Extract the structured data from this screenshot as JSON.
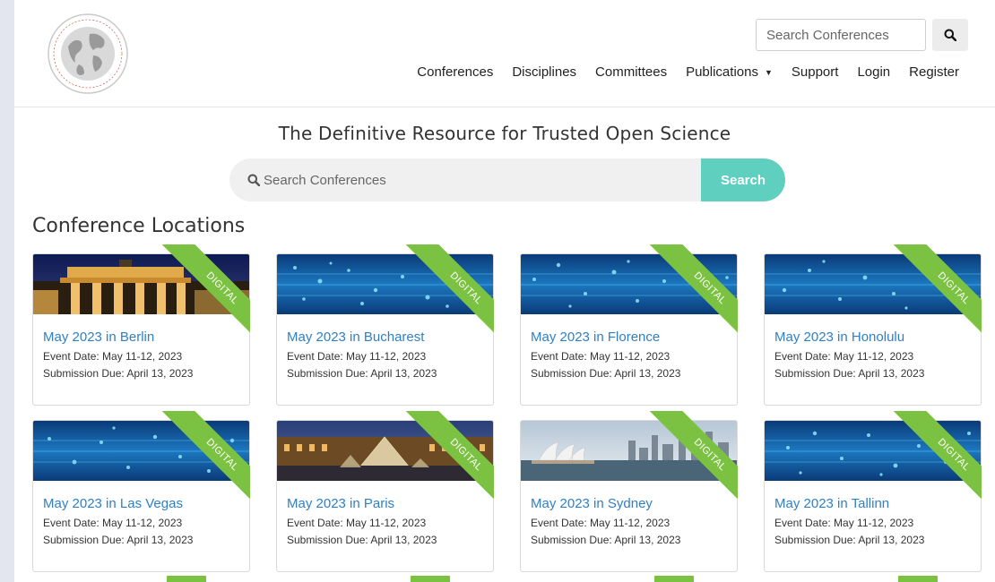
{
  "header": {
    "logo_text": "World Academy of Science, Engineering and Technology",
    "search_placeholder": "Search Conferences",
    "nav": [
      "Conferences",
      "Disciplines",
      "Committees",
      "Publications",
      "Support",
      "Login",
      "Register"
    ]
  },
  "hero": {
    "tagline": "The Definitive Resource for Trusted Open Science",
    "search_placeholder": "Search Conferences",
    "search_button": "Search"
  },
  "section_title": "Conference Locations",
  "ribbon_label": "DIGITAL",
  "cards": [
    {
      "title": "May 2023 in Berlin",
      "event": "Event Date: May 11-12, 2023",
      "due": "Submission Due: April 13, 2023",
      "image": "berlin"
    },
    {
      "title": "May 2023 in Bucharest",
      "event": "Event Date: May 11-12, 2023",
      "due": "Submission Due: April 13, 2023",
      "image": "digital"
    },
    {
      "title": "May 2023 in Florence",
      "event": "Event Date: May 11-12, 2023",
      "due": "Submission Due: April 13, 2023",
      "image": "digital"
    },
    {
      "title": "May 2023 in Honolulu",
      "event": "Event Date: May 11-12, 2023",
      "due": "Submission Due: April 13, 2023",
      "image": "digital"
    },
    {
      "title": "May 2023 in Las Vegas",
      "event": "Event Date: May 11-12, 2023",
      "due": "Submission Due: April 13, 2023",
      "image": "digital"
    },
    {
      "title": "May 2023 in Paris",
      "event": "Event Date: May 11-12, 2023",
      "due": "Submission Due: April 13, 2023",
      "image": "paris"
    },
    {
      "title": "May 2023 in Sydney",
      "event": "Event Date: May 11-12, 2023",
      "due": "Submission Due: April 13, 2023",
      "image": "sydney"
    },
    {
      "title": "May 2023 in Tallinn",
      "event": "Event Date: May 11-12, 2023",
      "due": "Submission Due: April 13, 2023",
      "image": "digital"
    }
  ],
  "colors": {
    "accent_teal": "#5fcfc0",
    "ribbon_green": "#7cc242",
    "link_blue": "#2f7fc8"
  }
}
